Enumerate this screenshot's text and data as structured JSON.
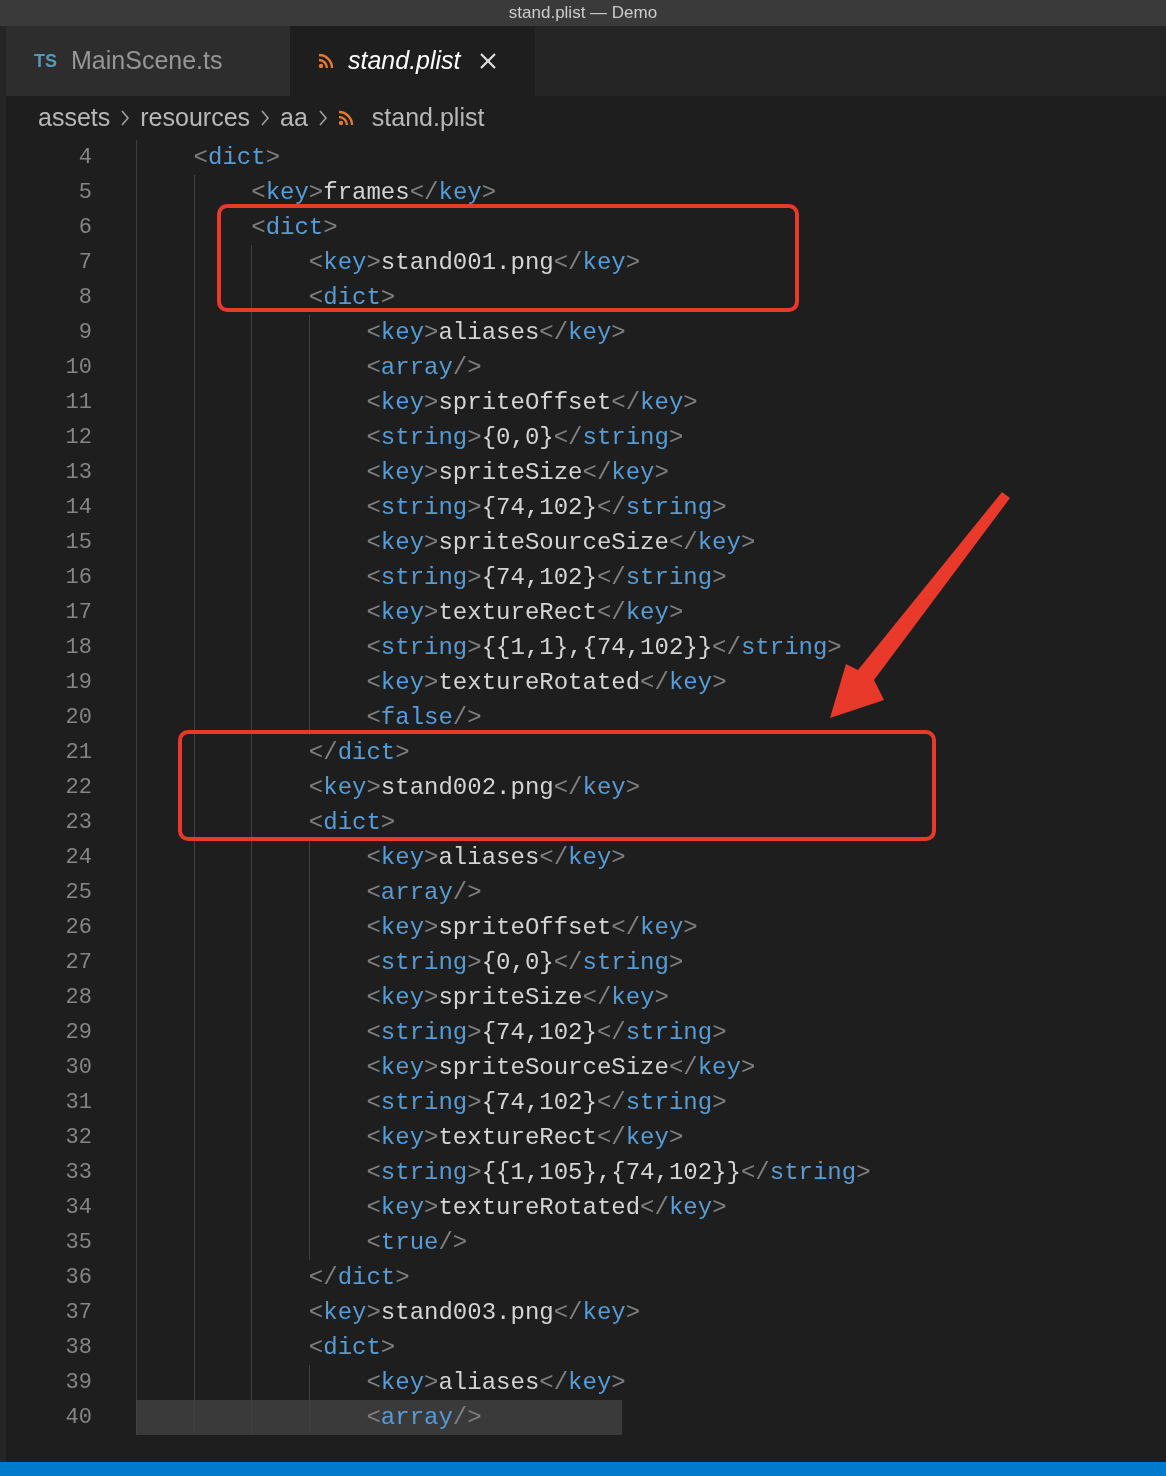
{
  "window": {
    "title": "stand.plist — Demo"
  },
  "tabs": [
    {
      "label": "MainScene.ts",
      "badge": "TS",
      "kind": "typescript",
      "selected": false,
      "italic": false
    },
    {
      "label": "stand.plist",
      "kind": "feed",
      "selected": true,
      "italic": true
    }
  ],
  "breadcrumbs": [
    {
      "label": "assets",
      "kind": "folder"
    },
    {
      "label": "resources",
      "kind": "folder"
    },
    {
      "label": "aa",
      "kind": "folder"
    },
    {
      "label": "stand.plist",
      "kind": "feed"
    }
  ],
  "editor": {
    "lines": [
      {
        "number": "4",
        "code": "    <dict>",
        "highlighted": false
      },
      {
        "number": "5",
        "code": "        <key>frames</key>",
        "highlighted": false
      },
      {
        "number": "6",
        "code": "        <dict>",
        "highlighted": false
      },
      {
        "number": "7",
        "code": "            <key>stand001.png</key>",
        "highlighted": false
      },
      {
        "number": "8",
        "code": "            <dict>",
        "highlighted": false
      },
      {
        "number": "9",
        "code": "                <key>aliases</key>",
        "highlighted": false
      },
      {
        "number": "10",
        "code": "                <array/>",
        "highlighted": false
      },
      {
        "number": "11",
        "code": "                <key>spriteOffset</key>",
        "highlighted": false
      },
      {
        "number": "12",
        "code": "                <string>{0,0}</string>",
        "highlighted": false
      },
      {
        "number": "13",
        "code": "                <key>spriteSize</key>",
        "highlighted": false
      },
      {
        "number": "14",
        "code": "                <string>{74,102}</string>",
        "highlighted": false
      },
      {
        "number": "15",
        "code": "                <key>spriteSourceSize</key>",
        "highlighted": false
      },
      {
        "number": "16",
        "code": "                <string>{74,102}</string>",
        "highlighted": false
      },
      {
        "number": "17",
        "code": "                <key>textureRect</key>",
        "highlighted": false
      },
      {
        "number": "18",
        "code": "                <string>{{1,1},{74,102}}</string>",
        "highlighted": false
      },
      {
        "number": "19",
        "code": "                <key>textureRotated</key>",
        "highlighted": false
      },
      {
        "number": "20",
        "code": "                <false/>",
        "highlighted": false
      },
      {
        "number": "21",
        "code": "            </dict>",
        "highlighted": false
      },
      {
        "number": "22",
        "code": "            <key>stand002.png</key>",
        "highlighted": false
      },
      {
        "number": "23",
        "code": "            <dict>",
        "highlighted": false
      },
      {
        "number": "24",
        "code": "                <key>aliases</key>",
        "highlighted": false
      },
      {
        "number": "25",
        "code": "                <array/>",
        "highlighted": false
      },
      {
        "number": "26",
        "code": "                <key>spriteOffset</key>",
        "highlighted": false
      },
      {
        "number": "27",
        "code": "                <string>{0,0}</string>",
        "highlighted": false
      },
      {
        "number": "28",
        "code": "                <key>spriteSize</key>",
        "highlighted": false
      },
      {
        "number": "29",
        "code": "                <string>{74,102}</string>",
        "highlighted": false
      },
      {
        "number": "30",
        "code": "                <key>spriteSourceSize</key>",
        "highlighted": false
      },
      {
        "number": "31",
        "code": "                <string>{74,102}</string>",
        "highlighted": false
      },
      {
        "number": "32",
        "code": "                <key>textureRect</key>",
        "highlighted": false
      },
      {
        "number": "33",
        "code": "                <string>{{1,105},{74,102}}</string>",
        "highlighted": false
      },
      {
        "number": "34",
        "code": "                <key>textureRotated</key>",
        "highlighted": false
      },
      {
        "number": "35",
        "code": "                <true/>",
        "highlighted": false
      },
      {
        "number": "36",
        "code": "            </dict>",
        "highlighted": false
      },
      {
        "number": "37",
        "code": "            <key>stand003.png</key>",
        "highlighted": false
      },
      {
        "number": "38",
        "code": "            <dict>",
        "highlighted": false
      },
      {
        "number": "39",
        "code": "                <key>aliases</key>",
        "highlighted": false
      },
      {
        "number": "40",
        "code": "                <array/>",
        "highlighted": true
      }
    ]
  }
}
